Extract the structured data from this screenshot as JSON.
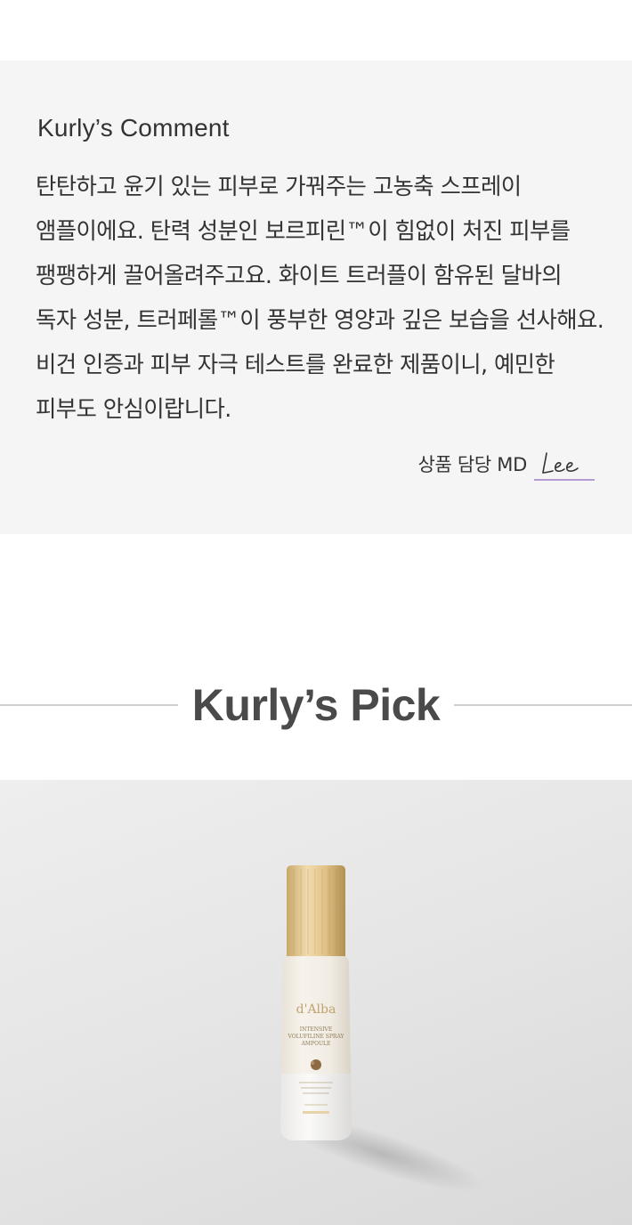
{
  "comment": {
    "title": "Kurly’s Comment",
    "body": "탄탄하고 윤기 있는 피부로 가꿔주는 고농축 스프레이 앰플이에요. 탄력 성분인 보르피린™이 힘없이 처진 피부를 팽팽하게 끌어올려주고요. 화이트 트러플이 함유된 달바의 독자 성분, 트러페롤™이 풍부한 영양과 깊은 보습을 선사해요. 비건 인증과 피부 자극 테스트를 완료한 제품이니, 예민한 피부도 안심이랍니다.",
    "md_label": "상품 담당 MD",
    "signature": "Lee"
  },
  "pick": {
    "title": "Kurly’s Pick"
  },
  "product_image": {
    "bottle_brand": "d'Alba",
    "bottle_line1": "INTENSIVE",
    "bottle_line2": "VOLUFILINE SPRAY",
    "bottle_line3": "AMPOULE"
  },
  "colors": {
    "comment_bg": "#f5f5f5",
    "text": "#333333",
    "signature_underline": "#9b7fc7",
    "pick_title": "#4a4a4a",
    "divider": "#cfcfcf"
  }
}
